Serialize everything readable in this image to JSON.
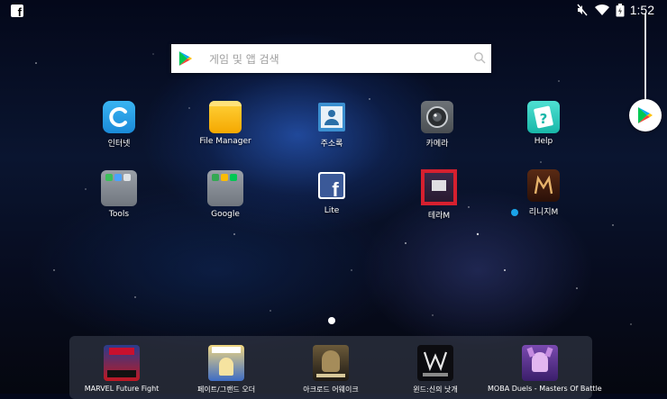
{
  "status_bar": {
    "time": "1:52",
    "notification_icon": "facebook-icon",
    "status_icons": [
      "mute-icon",
      "wifi-icon",
      "battery-icon"
    ]
  },
  "search": {
    "placeholder": "게임 및 앱 검색"
  },
  "apps": [
    {
      "label": "인터넷",
      "icon": "internet-icon"
    },
    {
      "label": "File Manager",
      "icon": "folder-icon"
    },
    {
      "label": "주소록",
      "icon": "contacts-icon"
    },
    {
      "label": "카메라",
      "icon": "camera-icon"
    },
    {
      "label": "Help",
      "icon": "help-icon"
    },
    {
      "label": "Tools",
      "icon": "tools-folder-icon"
    },
    {
      "label": "Google",
      "icon": "google-folder-icon"
    },
    {
      "label": "Lite",
      "icon": "facebook-lite-icon"
    },
    {
      "label": "테라M",
      "icon": "tera-m-icon"
    },
    {
      "label": "리니지M",
      "icon": "lineage-m-icon"
    }
  ],
  "tray": [
    {
      "label": "MARVEL Future Fight",
      "icon": "marvel-future-fight-icon"
    },
    {
      "label": "페이트/그랜드 오더",
      "icon": "fate-grand-order-icon"
    },
    {
      "label": "아크로드 어웨이크",
      "icon": "arcrod-awake-icon"
    },
    {
      "label": "윈드:신의 낫개",
      "icon": "wind-game-icon"
    },
    {
      "label": "MOBA Duels - Masters Of Battle",
      "icon": "moba-duels-icon"
    }
  ],
  "colors": {
    "accent_blue": "#1aa3e8",
    "play_green": "#00c853",
    "tera_red": "#d6202f"
  }
}
